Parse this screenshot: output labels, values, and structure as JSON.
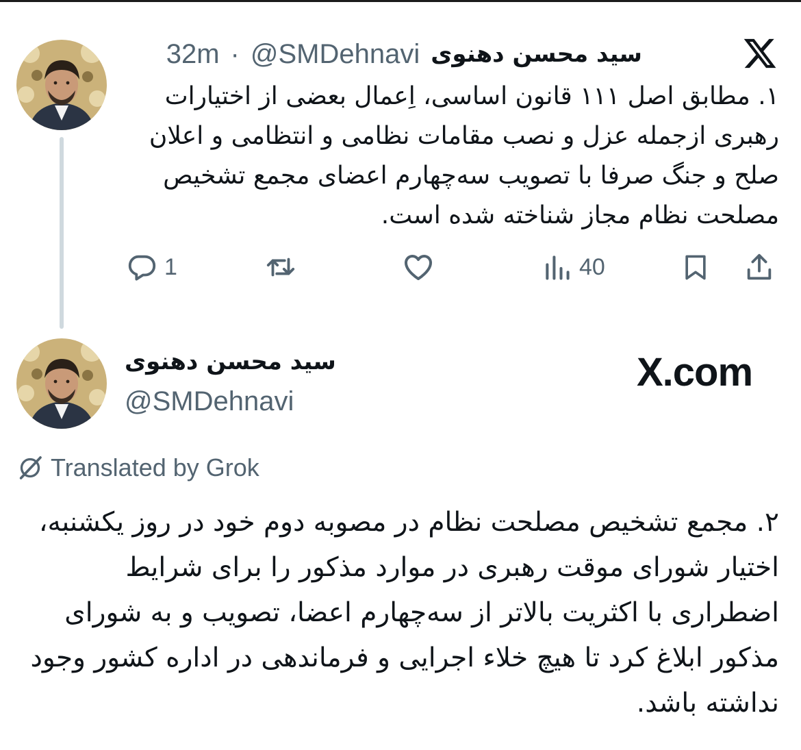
{
  "tweet1": {
    "author_name": "سید محسن دهنوی",
    "handle": "@SMDehnavi",
    "separator": "·",
    "time": "32m",
    "text": "۱. مطابق اصل ۱۱۱ قانون اساسی، اِعمال بعضی از اختیارات رهبری ازجمله عزل و نصب مقامات نظامی و انتظامی و اعلان صلح و جنگ صرفا با تصویب سه‌چهارم اعضای مجمع تشخیص مصلحت نظام مجاز شناخته شده است.",
    "reply_count": "1",
    "view_count": "40",
    "icons": {
      "reply": "reply-icon",
      "retweet": "retweet-icon",
      "like": "heart-icon",
      "views": "views-icon",
      "bookmark": "bookmark-icon",
      "share": "share-icon",
      "platform": "x-logo-icon"
    }
  },
  "tweet2": {
    "author_name": "سید محسن دهنوی",
    "handle": "@SMDehnavi",
    "brand": "X.com",
    "translated_label": "Translated by Grok",
    "text": "۲. مجمع تشخیص مصلحت نظام در مصوبه دوم خود در روز یکشنبه، اختیار شورای موقت رهبری در موارد مذکور را برای شرایط اضطراری با اکثریت بالاتر از سه‌چهارم اعضا، تصویب و به شورای مذکور ابلاغ کرد تا هیچ خلاء اجرایی و فرماندهی در اداره کشور وجود نداشته باشد."
  },
  "colors": {
    "text": "#0f1419",
    "secondary": "#536471",
    "thread_line": "#cfd9de"
  }
}
